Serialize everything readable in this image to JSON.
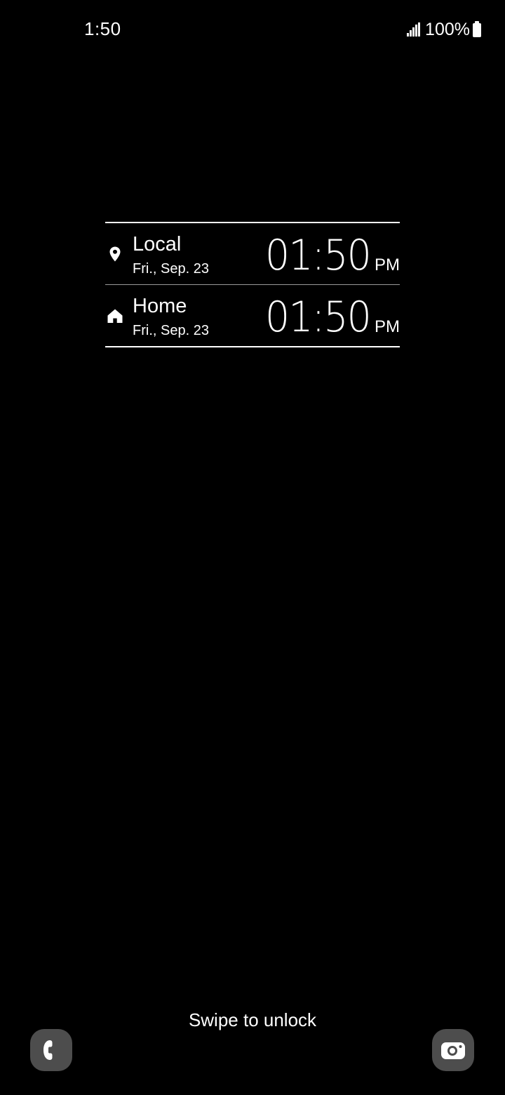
{
  "status_bar": {
    "time": "1:50",
    "battery_percent": "100%",
    "signal_icon": "signal-bars-icon",
    "battery_icon": "battery-full-icon"
  },
  "clocks": [
    {
      "icon": "location-pin-icon",
      "name": "Local",
      "date": "Fri., Sep. 23",
      "time": "01:50",
      "ampm": "PM"
    },
    {
      "icon": "home-icon",
      "name": "Home",
      "date": "Fri., Sep. 23",
      "time": "01:50",
      "ampm": "PM"
    }
  ],
  "lock_screen": {
    "swipe_hint": "Swipe to unlock",
    "left_shortcut_icon": "phone-icon",
    "right_shortcut_icon": "camera-icon"
  },
  "colors": {
    "background": "#000000",
    "text": "#ffffff",
    "shortcut_bg": "#4d4d4d"
  }
}
